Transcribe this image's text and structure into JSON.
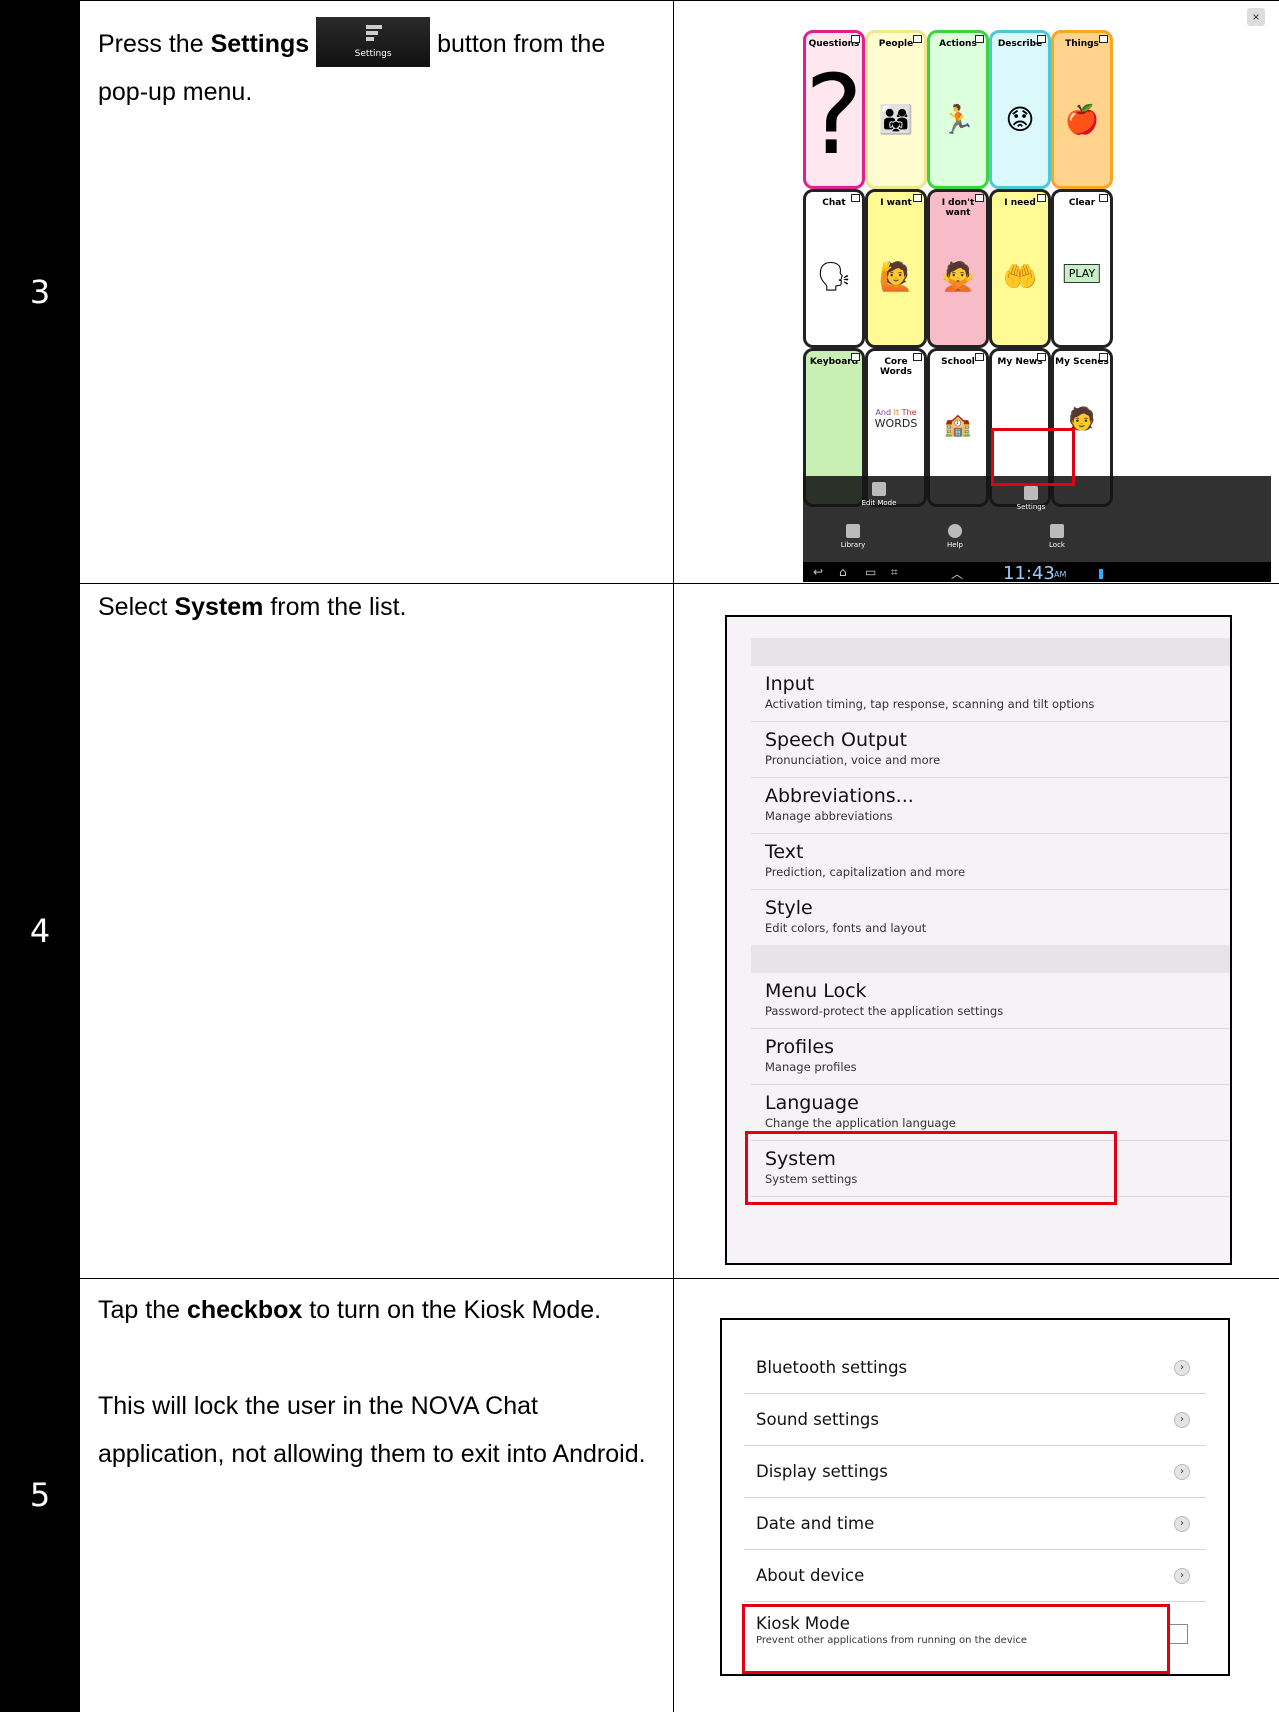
{
  "steps": [
    {
      "number": "3",
      "pre": "Press the ",
      "bold": "Settings",
      "post": " button from the pop-up menu.",
      "settings_btn_label": "Settings",
      "tablet": {
        "close": "×",
        "cells": [
          "Questions",
          "People",
          "Actions",
          "Describe",
          "Things",
          "Chat",
          "I want",
          "I don't want",
          "I need",
          "Clear",
          "Keyboard",
          "Core Words",
          "School",
          "My News",
          "My Scenes"
        ],
        "menu": [
          "Edit Mode",
          "Settings",
          "Library",
          "Help",
          "Lock"
        ],
        "clock": "11:43",
        "ampm": "AM",
        "core_words_pic": [
          "And",
          "It",
          "The",
          "WORDS"
        ],
        "clear_pic": "PLAY"
      }
    },
    {
      "number": "4",
      "pre": "Select ",
      "bold": "System",
      "post": " from the list.",
      "items": [
        {
          "title": "Input",
          "sub": "Activation timing, tap response, scanning and tilt options"
        },
        {
          "title": "Speech Output",
          "sub": "Pronunciation, voice and more"
        },
        {
          "title": "Abbreviations...",
          "sub": "Manage abbreviations"
        },
        {
          "title": "Text",
          "sub": "Prediction, capitalization and more"
        },
        {
          "title": "Style",
          "sub": "Edit colors, fonts and layout"
        },
        {
          "title": "Menu Lock",
          "sub": "Password-protect the application settings"
        },
        {
          "title": "Profiles",
          "sub": "Manage profiles"
        },
        {
          "title": "Language",
          "sub": "Change the application language"
        },
        {
          "title": "System",
          "sub": "System settings"
        }
      ]
    },
    {
      "number": "5",
      "pre": "Tap the ",
      "bold": "checkbox",
      "post": " to turn on the Kiosk Mode.",
      "para2": "This will lock the user in the NOVA Chat application, not allowing them to exit into Android.",
      "rows": [
        "Bluetooth settings",
        "Sound settings",
        "Display settings",
        "Date and time",
        "About device"
      ],
      "kiosk_title": "Kiosk Mode",
      "kiosk_sub": "Prevent other applications from running on the device"
    }
  ],
  "colors": {
    "highlight": "#e00012",
    "header_bg": "#000000"
  }
}
